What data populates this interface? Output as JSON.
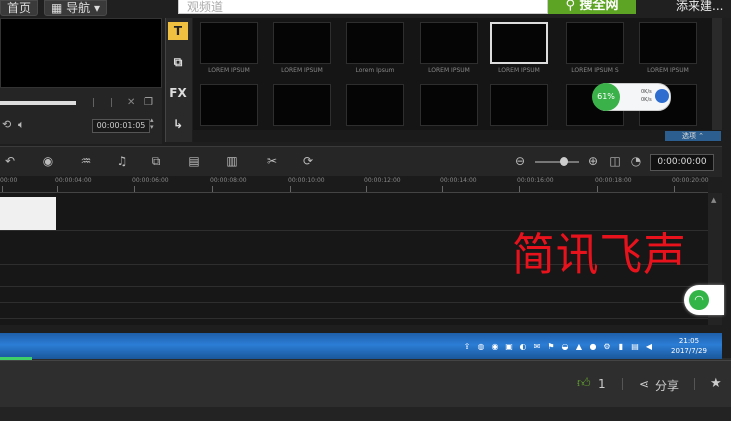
{
  "top": {
    "home_label": "首页",
    "nav_label": "导航",
    "search_placeholder": "观频道",
    "search_button": "搜全网",
    "right_text": "添来建..."
  },
  "preview": {
    "timecode": "00:00:01:05"
  },
  "side_tools": [
    "T",
    "FX"
  ],
  "library": {
    "thumbs": [
      {
        "caption": "LOREM IPSUM"
      },
      {
        "caption": "LOREM IPSUM"
      },
      {
        "caption": "Lorem Ipsum"
      },
      {
        "caption": "LOREM IPSUM"
      },
      {
        "caption": "LOREM IPSUM"
      },
      {
        "caption": "LOREM IPSUM S"
      },
      {
        "caption": "LOREM IPSUM"
      },
      {
        "caption": ""
      },
      {
        "caption": ""
      },
      {
        "caption": ""
      },
      {
        "caption": ""
      },
      {
        "caption": ""
      },
      {
        "caption": ""
      },
      {
        "caption": ""
      }
    ],
    "bottom_button": "选项",
    "speed_percent": "61%",
    "speed_up": "0K/s",
    "speed_down": "0K/s"
  },
  "timeline": {
    "timecode": "0:00:00:00",
    "ruler_labels": [
      "00:00",
      "00:00:04:00",
      "00:00:06:00",
      "00:00:08:00",
      "00:00:10:00",
      "00:00:12:00",
      "00:00:14:00",
      "00:00:16:00",
      "00:00:18:00",
      "00:00:20:00"
    ]
  },
  "watermark": "简讯飞声",
  "taskbar": {
    "time": "21:05",
    "date": "2017/7/29"
  },
  "bottom": {
    "like_count": "1",
    "share_label": "分享"
  },
  "colors": {
    "search_button": "#5da424",
    "like_icon": "#64a72e",
    "watermark": "#e8121c",
    "taskbar": "#2b7dd6"
  }
}
